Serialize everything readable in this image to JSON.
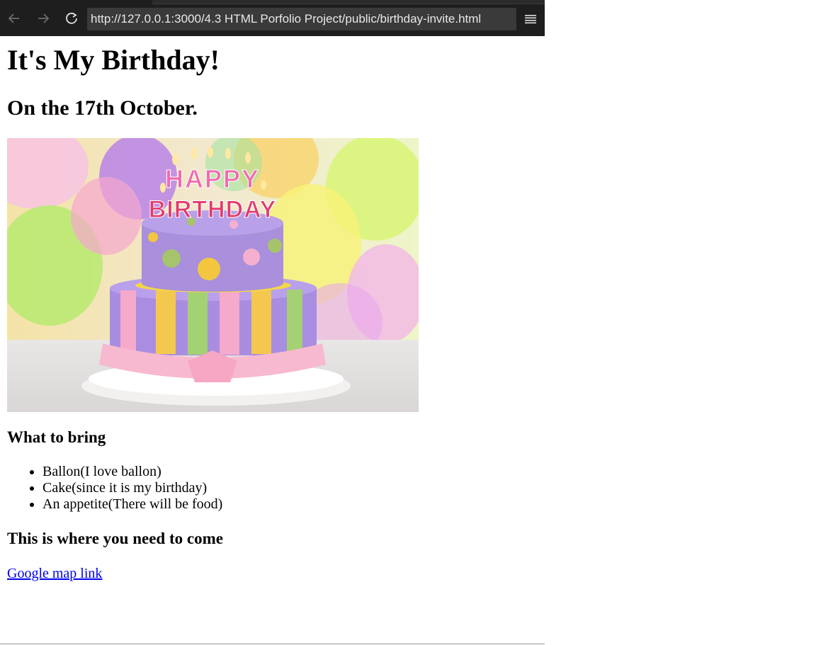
{
  "browser": {
    "url": "http://127.0.0.1:3000/4.3 HTML Porfolio Project/public/birthday-invite.html",
    "back_icon": "arrow-left-icon",
    "forward_icon": "arrow-right-icon",
    "reload_icon": "reload-icon",
    "menu_icon": "hamburger-menu-icon"
  },
  "page": {
    "title": "It's My Birthday!",
    "subtitle": "On the 17th October.",
    "image_text": "HAPPY BIRTHDAY",
    "bring_heading": "What to bring",
    "bring_items": [
      "Ballon(I love ballon)",
      "Cake(since it is my birthday)",
      "An appetite(There will be food)"
    ],
    "where_heading": "This is where you need to come",
    "map_link_text": "Google map link"
  },
  "colors": {
    "chrome_bg": "#1e1e1e",
    "url_bg": "#3a3a3a",
    "link": "#0000ee"
  }
}
